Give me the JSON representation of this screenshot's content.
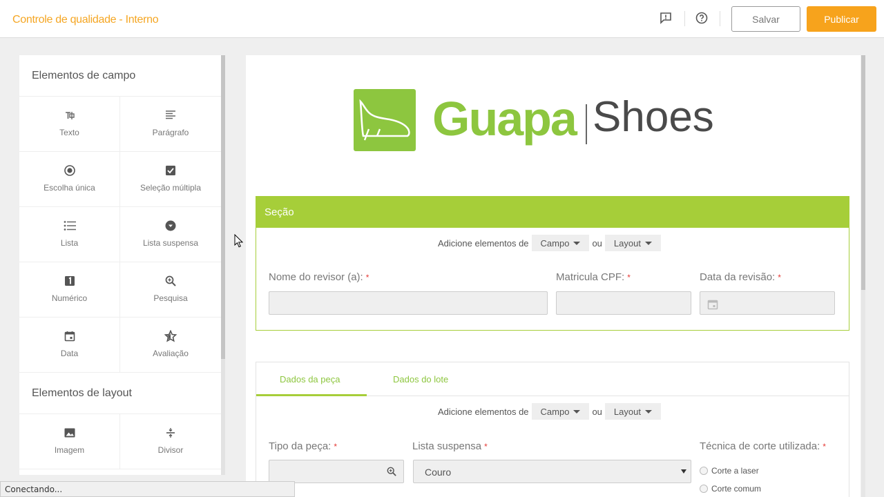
{
  "header": {
    "title": "Controle de qualidade - Interno",
    "save_label": "Salvar",
    "publish_label": "Publicar",
    "icons": [
      "feedback-icon",
      "help-icon"
    ]
  },
  "sidebar": {
    "field_heading": "Elementos de campo",
    "field_items": [
      {
        "label": "Texto",
        "icon": "text-field-icon"
      },
      {
        "label": "Parágrafo",
        "icon": "paragraph-icon"
      },
      {
        "label": "Escolha única",
        "icon": "radio-icon"
      },
      {
        "label": "Seleção múltipla",
        "icon": "checkbox-icon"
      },
      {
        "label": "Lista",
        "icon": "list-icon"
      },
      {
        "label": "Lista suspensa",
        "icon": "dropdown-icon"
      },
      {
        "label": "Numérico",
        "icon": "numeric-icon"
      },
      {
        "label": "Pesquisa",
        "icon": "search-icon"
      },
      {
        "label": "Data",
        "icon": "calendar-icon"
      },
      {
        "label": "Avaliação",
        "icon": "star-icon"
      }
    ],
    "layout_heading": "Elementos de layout",
    "layout_items": [
      {
        "label": "Imagem",
        "icon": "image-icon"
      },
      {
        "label": "Divisor",
        "icon": "divider-icon"
      }
    ]
  },
  "logo": {
    "word1": "Guapa",
    "word2": "Shoes",
    "brand_color": "#8dc63f"
  },
  "section": {
    "title": "Seção",
    "add_prefix": "Adicione elementos de",
    "campo": "Campo",
    "ou": "ou",
    "layout": "Layout",
    "required_mark": "*",
    "fields": {
      "reviewer": "Nome do revisor (a):",
      "cpf": "Matricula CPF:",
      "date": "Data da revisão:"
    }
  },
  "tabs": {
    "items": [
      "Dados da peça",
      "Dados do lote"
    ],
    "active": 0,
    "add_prefix": "Adicione elementos de",
    "campo": "Campo",
    "ou": "ou",
    "layout": "Layout",
    "fields": {
      "piece_type": "Tipo da peça:",
      "dropdown": "Lista suspensa",
      "dropdown_value": "Couro",
      "cut_technique": "Técnica de corte utilizada:",
      "options": [
        "Corte a laser",
        "Corte comum"
      ]
    }
  },
  "status": {
    "text": "Conectando..."
  },
  "colors": {
    "accent": "#f7a31c",
    "section": "#a6ce39"
  }
}
